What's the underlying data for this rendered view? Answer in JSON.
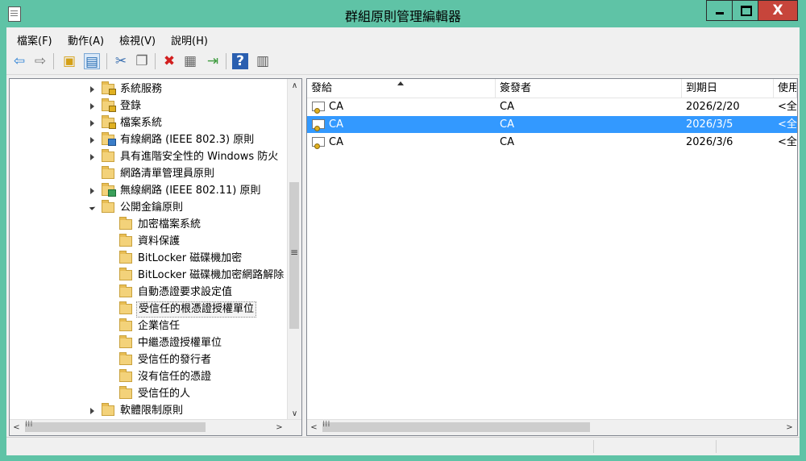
{
  "window": {
    "title": "群組原則管理編輯器",
    "close_glyph": "X",
    "accent_color": "#5fc3a6"
  },
  "menu": [
    {
      "label": "檔案(F)"
    },
    {
      "label": "動作(A)"
    },
    {
      "label": "檢視(V)"
    },
    {
      "label": "說明(H)"
    }
  ],
  "toolbar": {
    "icons": [
      "back-icon",
      "forward-icon",
      "up-folder-icon",
      "show-hide-tree-icon",
      "cut-icon",
      "copy-icon",
      "delete-icon",
      "properties-icon",
      "export-icon",
      "help-icon",
      "details-view-icon"
    ]
  },
  "tree": {
    "items": [
      {
        "label": "系統服務",
        "expander": "collapsed",
        "icon": "folder-lock-icon"
      },
      {
        "label": "登錄",
        "expander": "collapsed",
        "icon": "folder-lock-icon"
      },
      {
        "label": "檔案系統",
        "expander": "collapsed",
        "icon": "folder-lock-icon"
      },
      {
        "label": "有線網路 (IEEE 802.3) 原則",
        "expander": "collapsed",
        "icon": "network-policy-icon"
      },
      {
        "label": "具有進階安全性的 Windows 防火",
        "expander": "collapsed",
        "icon": "folder-icon"
      },
      {
        "label": "網路清單管理員原則",
        "expander": "none",
        "icon": "folder-icon"
      },
      {
        "label": "無線網路 (IEEE 802.11) 原則",
        "expander": "collapsed",
        "icon": "wireless-policy-icon"
      },
      {
        "label": "公開金鑰原則",
        "expander": "expanded",
        "icon": "folder-icon"
      },
      {
        "label": "加密檔案系統",
        "expander": "none",
        "icon": "folder-icon"
      },
      {
        "label": "資料保護",
        "expander": "none",
        "icon": "folder-icon"
      },
      {
        "label": "BitLocker 磁碟機加密",
        "expander": "none",
        "icon": "folder-icon"
      },
      {
        "label": "BitLocker 磁碟機加密網路解除",
        "expander": "none",
        "icon": "folder-icon"
      },
      {
        "label": "自動憑證要求設定值",
        "expander": "none",
        "icon": "folder-icon"
      },
      {
        "label": "受信任的根憑證授權單位",
        "expander": "none",
        "icon": "folder-icon",
        "selected": true
      },
      {
        "label": "企業信任",
        "expander": "none",
        "icon": "folder-icon"
      },
      {
        "label": "中繼憑證授權單位",
        "expander": "none",
        "icon": "folder-icon"
      },
      {
        "label": "受信任的發行者",
        "expander": "none",
        "icon": "folder-icon"
      },
      {
        "label": "沒有信任的憑證",
        "expander": "none",
        "icon": "folder-icon"
      },
      {
        "label": "受信任的人",
        "expander": "none",
        "icon": "folder-icon"
      },
      {
        "label": "軟體限制原則",
        "expander": "collapsed",
        "icon": "folder-icon"
      }
    ]
  },
  "list": {
    "columns": [
      "發給",
      "簽發者",
      "到期日",
      "使用"
    ],
    "rows": [
      {
        "issued_to": "CA",
        "issued_by": "CA",
        "expiry": "2026/2/20",
        "purpose": "<全"
      },
      {
        "issued_to": "CA",
        "issued_by": "CA",
        "expiry": "2026/3/5",
        "purpose": "<全",
        "selected": true
      },
      {
        "issued_to": "CA",
        "issued_by": "CA",
        "expiry": "2026/3/6",
        "purpose": "<全"
      }
    ],
    "selection_color": "#3399ff"
  },
  "scroll": {
    "up": "∧",
    "down": "∨",
    "left": "<",
    "right": ">"
  }
}
